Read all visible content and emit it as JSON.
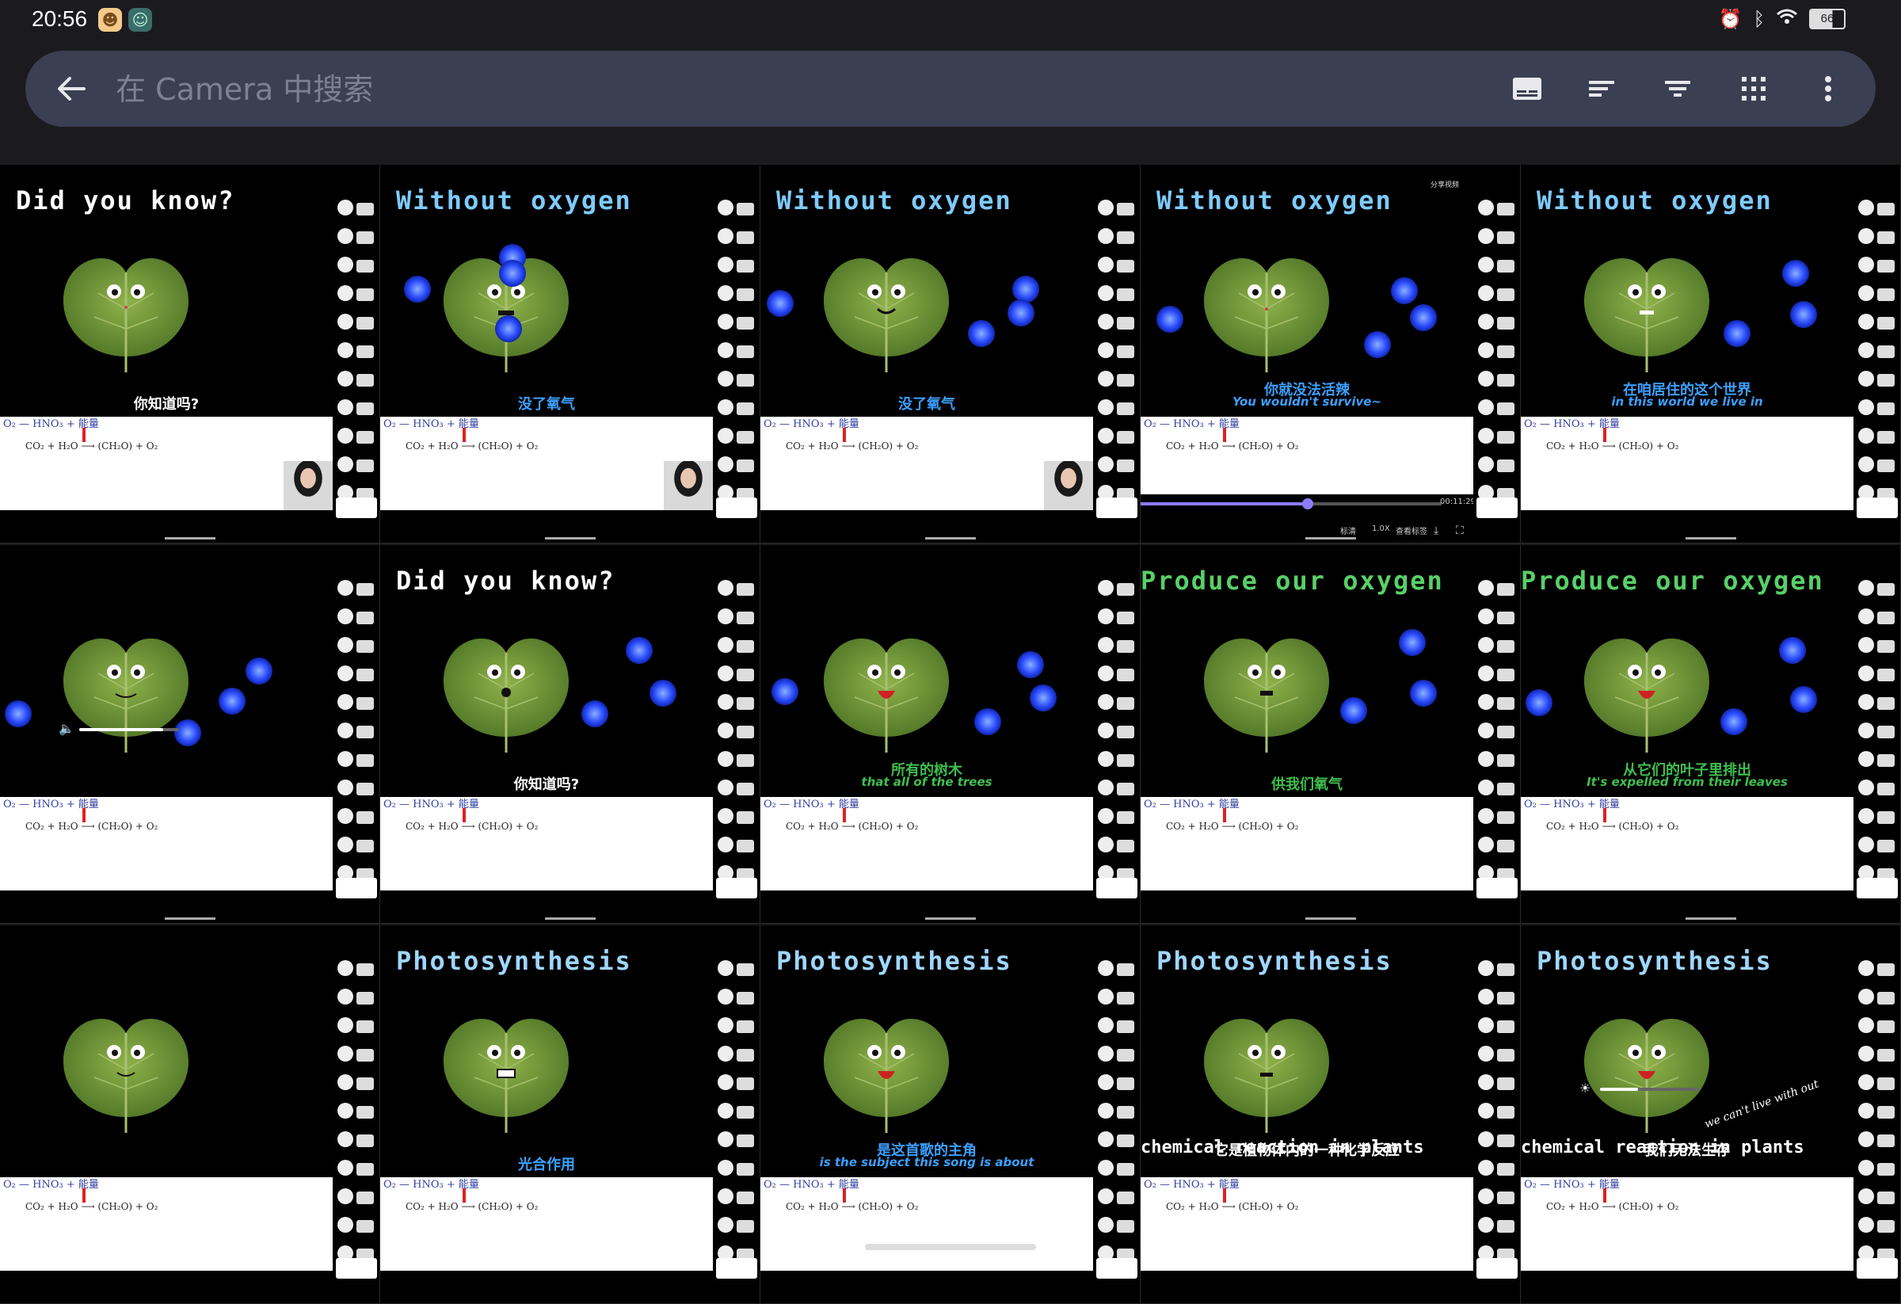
{
  "status": {
    "time": "20:56",
    "battery": "66"
  },
  "search": {
    "placeholder": "在 Camera 中搜索"
  },
  "toolbar": {
    "icons": [
      "subtitles-icon",
      "sort-icon",
      "filter-icon",
      "grid-view-icon",
      "more-vert-icon"
    ]
  },
  "formula": {
    "top": "O₂ — HNO₃ + 能量",
    "energy": "能量",
    "main": "CO₂ + H₂O ⟶ (CH₂O) + O₂"
  },
  "thumbnails": [
    {
      "title": "Did you know?",
      "title_color": "#ffffff",
      "cn": "你知道吗?",
      "en": "",
      "sub_color": "#ffffff"
    },
    {
      "title": "Without oxygen",
      "title_color": "#7ecbff",
      "cn": "没了氧气",
      "en": "",
      "sub_color": "#3da0ff"
    },
    {
      "title": "Without oxygen",
      "title_color": "#7ecbff",
      "cn": "没了氧气",
      "en": "",
      "sub_color": "#3da0ff"
    },
    {
      "title": "Without oxygen",
      "title_color": "#7ecbff",
      "cn": "你就没法活辣",
      "en": "You wouldn't survive~",
      "sub_color": "#3da0ff",
      "player": {
        "time": "00:11:29",
        "speed": "1.0X",
        "label_a": "标清",
        "label_b": "查看标签",
        "share": "分享视频"
      }
    },
    {
      "title": "Without oxygen",
      "title_color": "#7ecbff",
      "cn": "在咱居住的这个世界",
      "en": "in this world we live in",
      "sub_color": "#3da0ff"
    },
    {
      "title": "",
      "title_color": "#ffffff",
      "cn": "",
      "en": "",
      "sub_color": "#ffffff"
    },
    {
      "title": "Did you know?",
      "title_color": "#ffffff",
      "cn": "你知道吗?",
      "en": "",
      "sub_color": "#ffffff"
    },
    {
      "title": "",
      "title_color": "#ffffff",
      "cn": "所有的树木",
      "en": "that all of the trees",
      "sub_color": "#3fbf4f"
    },
    {
      "title": "Produce our oxygen",
      "title_color": "#58d068",
      "cn": "供我们氧气",
      "en": "",
      "sub_color": "#3fbf4f"
    },
    {
      "title": "Produce our oxygen",
      "title_color": "#58d068",
      "cn": "从它们的叶子里排出",
      "en": "It's expelled from their leaves",
      "sub_color": "#3fbf4f"
    },
    {
      "title": "",
      "title_color": "#ffffff",
      "cn": "",
      "en": "",
      "sub_color": "#ffffff"
    },
    {
      "title": "Photosynthesis",
      "title_color": "#9fd6ff",
      "cn": "光合作用",
      "en": "",
      "sub_color": "#3da0ff"
    },
    {
      "title": "Photosynthesis",
      "title_color": "#9fd6ff",
      "cn": "是这首歌的主角",
      "en": "is the subject this song is about",
      "sub_color": "#3da0ff"
    },
    {
      "title": "Photosynthesis",
      "title_color": "#9fd6ff",
      "cn": "它是植物体内的一种化学反应",
      "en": "chemical reaction in plants",
      "sub_color": "#ffffff"
    },
    {
      "title": "Photosynthesis",
      "title_color": "#9fd6ff",
      "cn": "我们无法生存",
      "en": "chemical reaction in plants",
      "sub_color": "#ffffff",
      "extra": "we can't live with out"
    }
  ]
}
